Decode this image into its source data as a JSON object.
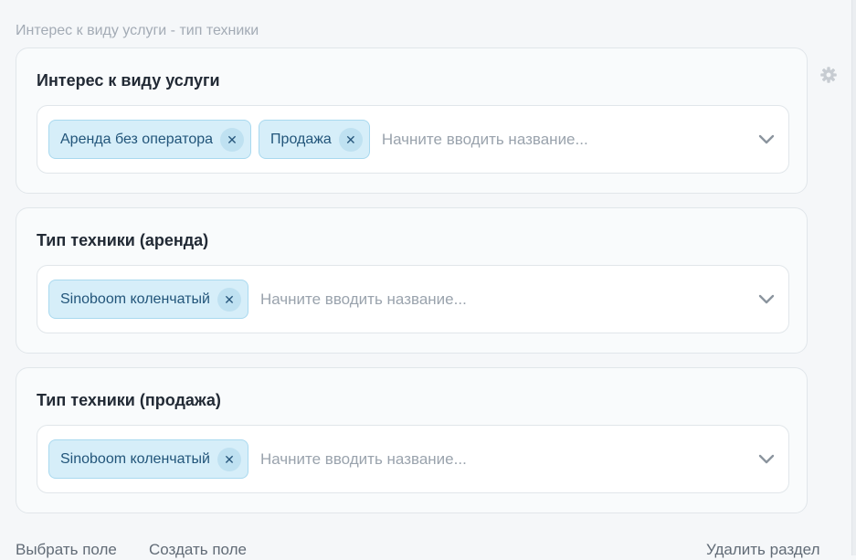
{
  "section": {
    "title": "Интерес к виду услуги - тип техники"
  },
  "fields": [
    {
      "title": "Интерес к виду услуги",
      "chips": [
        "Аренда без оператора",
        "Продажа"
      ],
      "placeholder": "Начните вводить название..."
    },
    {
      "title": "Тип техники (аренда)",
      "chips": [
        "Sinoboom коленчатый"
      ],
      "placeholder": "Начните вводить название..."
    },
    {
      "title": "Тип техники (продажа)",
      "chips": [
        "Sinoboom коленчатый"
      ],
      "placeholder": "Начните вводить название..."
    }
  ],
  "icons": {
    "remove_glyph": "✕",
    "settings": "gear-icon",
    "dropdown": "chevron-down-icon"
  },
  "footer": {
    "choose_field": "Выбрать поле",
    "create_field": "Создать поле",
    "delete_section": "Удалить раздел"
  },
  "colors": {
    "chip_bg": "#d6eef9",
    "chip_border": "#a9d9ef",
    "chip_text": "#22557a",
    "placeholder": "#9aa3ad",
    "section_title": "#a3abb5"
  }
}
